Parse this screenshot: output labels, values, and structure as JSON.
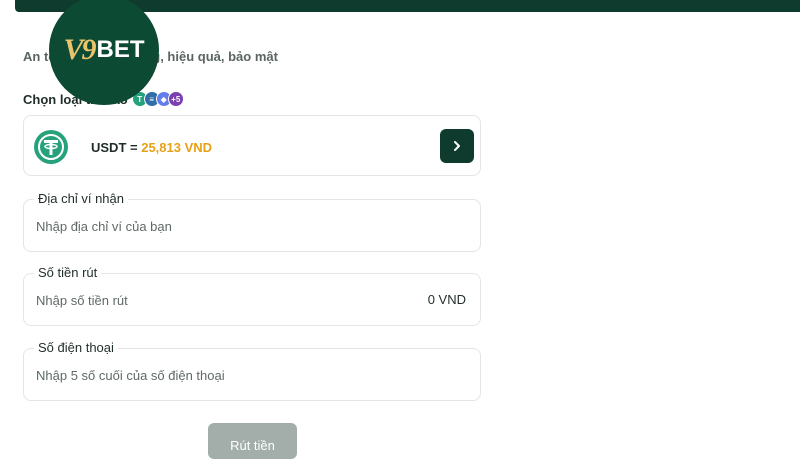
{
  "brand": {
    "logo_mark": "V9",
    "logo_text": "BET"
  },
  "tagline": "An toàn, nhanh chóng, hiệu quả, bảo mật",
  "coin_select": {
    "label": "Chọn loại tiền ảo",
    "chips": [
      {
        "text": "T",
        "color": "#26a17b"
      },
      {
        "text": "≡",
        "color": "#2f6ea8"
      },
      {
        "text": "◆",
        "color": "#627eea"
      },
      {
        "text": "+5",
        "color": "#7b3fb0"
      }
    ],
    "coin_name": "USDT",
    "equals": " = ",
    "rate": "25,813 VND",
    "icon": "tether-icon",
    "next_icon": "chevron-right-icon"
  },
  "fields": {
    "wallet": {
      "label": "Địa chỉ ví nhận",
      "placeholder": "Nhập địa chỉ ví của bạn"
    },
    "amount": {
      "label": "Số tiền rút",
      "placeholder": "Nhập số tiền rút",
      "suffix": "0 VND"
    },
    "phone": {
      "label": "Số điện thoại",
      "placeholder": "Nhập 5 số cuối của số điện thoại"
    }
  },
  "submit_label": "Rút tiền",
  "colors": {
    "brand_dark": "#0f3b2e",
    "accent_gold": "#e6a117",
    "tether_green": "#26a17b",
    "disabled_button": "#a3aeaa"
  }
}
